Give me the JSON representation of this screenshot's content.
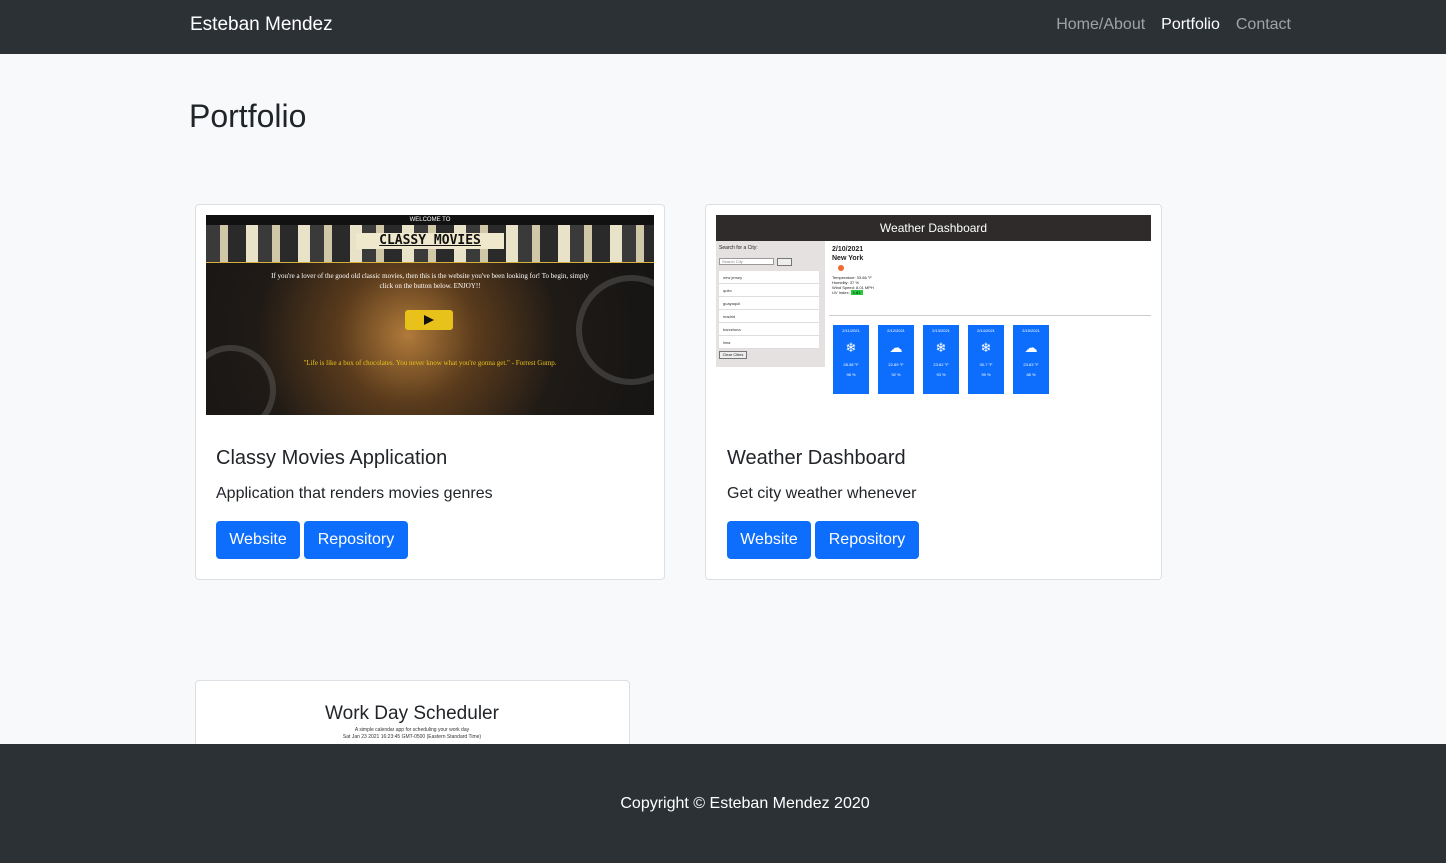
{
  "navbar": {
    "brand": "Esteban Mendez",
    "links": [
      "Home/About",
      "Portfolio",
      "Contact"
    ],
    "active": "Portfolio"
  },
  "page": {
    "title": "Portfolio"
  },
  "projects": [
    {
      "title": "Classy Movies Application",
      "description": "Application that renders movies genres",
      "buttons": [
        "Website",
        "Repository"
      ],
      "thumbnail": {
        "top_text": "WELCOME TO",
        "heading": "CLASSY MOVIES",
        "intro": "If you're a lover of the good old classic movies, then this is the website you've been looking for! To begin, simply click on the button below. ENJOY!!",
        "quote": "\"Life is like a box of chocolates. You never know what you're gonna get.\" - Forrest Gump."
      }
    },
    {
      "title": "Weather Dashboard",
      "description": "Get city weather whenever",
      "buttons": [
        "Website",
        "Repository"
      ],
      "thumbnail": {
        "heading": "Weather Dashboard",
        "search_label": "Search for a City:",
        "search_placeholder": "Search City",
        "cities": [
          "new jersey",
          "quito",
          "guayaquil",
          "madrid",
          "barcelona",
          "lima"
        ],
        "clear_label": "Clear Cities",
        "date": "2/10/2021",
        "city": "New York",
        "temperature": "Temperature: 33.66 °F",
        "humidity": "Humidity: 37 %",
        "wind": "Wind Speed: 8.01 MPH",
        "uv_label": "UV Index:",
        "uv_value": "1.81",
        "forecast": [
          {
            "date": "2/11/2021",
            "icon": "snow",
            "temp": "28.38 °F",
            "humidity": "98 %"
          },
          {
            "date": "2/12/2021",
            "icon": "cloud",
            "temp": "22.89 °F",
            "humidity": "92 %"
          },
          {
            "date": "2/13/2021",
            "icon": "snow",
            "temp": "23.62 °F",
            "humidity": "93 %"
          },
          {
            "date": "2/14/2021",
            "icon": "snow",
            "temp": "30.7 °F",
            "humidity": "99 %"
          },
          {
            "date": "2/15/2021",
            "icon": "cloud",
            "temp": "23.63 °F",
            "humidity": "88 %"
          }
        ]
      }
    },
    {
      "thumbnail": {
        "heading": "Work Day Scheduler",
        "subtitle": "A simple calendar app for scheduling your work day",
        "datetime": "Sat Jan 23 2021 16:23:45 GMT-0500 (Eastern Standard Time)"
      }
    }
  ],
  "footer": {
    "text": "Copyright © Esteban Mendez 2020"
  },
  "colors": {
    "navbar": "#2c3136",
    "primary": "#0d6efd",
    "background": "#f8f9fa"
  }
}
